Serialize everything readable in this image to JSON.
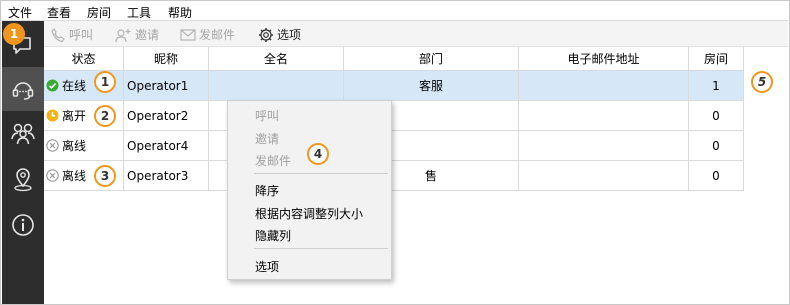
{
  "menu": [
    "文件",
    "查看",
    "房间",
    "工具",
    "帮助"
  ],
  "toolbar": {
    "call": "呼叫",
    "invite": "邀请",
    "send_mail": "发邮件",
    "options": "选项"
  },
  "table": {
    "headers": [
      "状态",
      "昵称",
      "全名",
      "部门",
      "电子邮件地址",
      "房间"
    ],
    "rows": [
      {
        "status": "在线",
        "status_kind": "online",
        "nick": "Operator1",
        "full": "",
        "dept": "客服",
        "email": "",
        "room": "1"
      },
      {
        "status": "离开",
        "status_kind": "away",
        "nick": "Operator2",
        "full": "",
        "dept": "",
        "email": "",
        "room": "0"
      },
      {
        "status": "离线",
        "status_kind": "offline",
        "nick": "Operator4",
        "full": "",
        "dept": "",
        "email": "",
        "room": "0"
      },
      {
        "status": "离线",
        "status_kind": "offline",
        "nick": "Operator3",
        "full": "",
        "dept": "售",
        "email": "",
        "room": "0"
      }
    ]
  },
  "context_menu": {
    "call": "呼叫",
    "invite": "邀请",
    "send_mail": "发邮件",
    "sort_desc": "降序",
    "autosize": "根据内容调整列大小",
    "hide_column": "隐藏列",
    "options": "选项"
  },
  "callouts": [
    "1",
    "1",
    "2",
    "3",
    "4",
    "5"
  ],
  "colors": {
    "sidebar": "#2d2d2d",
    "callout": "#f0961e",
    "online": "#3aaa35",
    "away": "#f2b413",
    "offline": "#9a9a9a",
    "selected_row": "#d6e8f7"
  }
}
